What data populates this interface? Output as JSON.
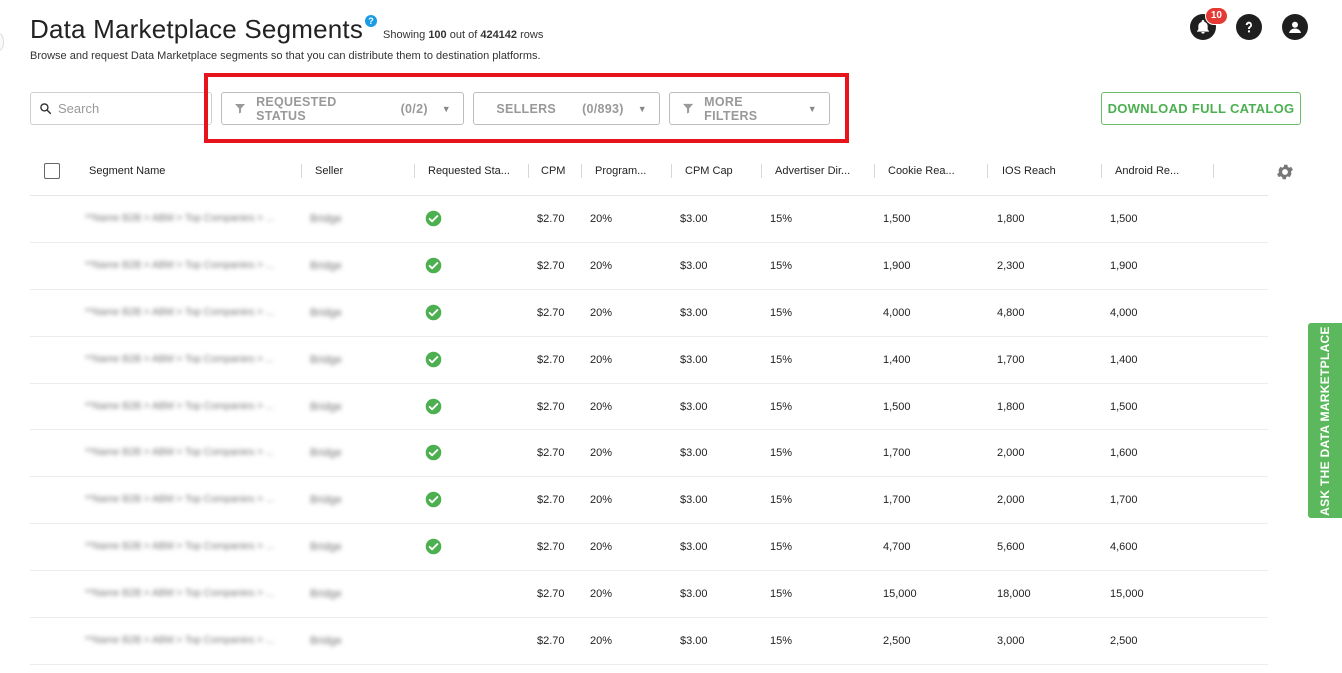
{
  "header": {
    "title": "Data Marketplace Segments",
    "help_glyph": "?",
    "showing_prefix": "Showing",
    "showing_count": "100",
    "showing_mid": "out of",
    "total_rows": "424142",
    "showing_suffix": "rows",
    "subtitle": "Browse and request Data Marketplace segments so that you can distribute them to destination platforms."
  },
  "top_icons": {
    "notifications_count": "10",
    "icons": [
      "bell-icon",
      "help-circle-icon",
      "user-avatar-icon"
    ]
  },
  "search": {
    "placeholder": "Search"
  },
  "filters": [
    {
      "label": "REQUESTED STATUS",
      "count": "(0/2)"
    },
    {
      "label": "SELLERS",
      "count": "(0/893)"
    },
    {
      "label": "MORE FILTERS",
      "count": ""
    }
  ],
  "download_label": "DOWNLOAD FULL CATALOG",
  "side_tab_label": "ASK THE DATA MARKETPLACE",
  "colors": {
    "accent_green": "#4caf50",
    "highlight_red": "#e8141c",
    "help_blue": "#1a9be6",
    "badge_red": "#e53935"
  },
  "table": {
    "columns": [
      "Segment Name",
      "Seller",
      "Requested Sta...",
      "CPM",
      "Program...",
      "CPM Cap",
      "Advertiser Dir...",
      "Cookie Rea...",
      "IOS Reach",
      "Android Re..."
    ],
    "rows": [
      {
        "name": "**Name B2B > ABM > Top Companies > ...",
        "seller": "Bridge",
        "requested": true,
        "cpm": "$2.70",
        "program": "20%",
        "cap": "$3.00",
        "adv": "15%",
        "cookie": "1,500",
        "ios": "1,800",
        "android": "1,500"
      },
      {
        "name": "**Name B2B > ABM > Top Companies > ...",
        "seller": "Bridge",
        "requested": true,
        "cpm": "$2.70",
        "program": "20%",
        "cap": "$3.00",
        "adv": "15%",
        "cookie": "1,900",
        "ios": "2,300",
        "android": "1,900"
      },
      {
        "name": "**Name B2B > ABM > Top Companies > ...",
        "seller": "Bridge",
        "requested": true,
        "cpm": "$2.70",
        "program": "20%",
        "cap": "$3.00",
        "adv": "15%",
        "cookie": "4,000",
        "ios": "4,800",
        "android": "4,000"
      },
      {
        "name": "**Name B2B > ABM > Top Companies > ...",
        "seller": "Bridge",
        "requested": true,
        "cpm": "$2.70",
        "program": "20%",
        "cap": "$3.00",
        "adv": "15%",
        "cookie": "1,400",
        "ios": "1,700",
        "android": "1,400"
      },
      {
        "name": "**Name B2B > ABM > Top Companies > ...",
        "seller": "Bridge",
        "requested": true,
        "cpm": "$2.70",
        "program": "20%",
        "cap": "$3.00",
        "adv": "15%",
        "cookie": "1,500",
        "ios": "1,800",
        "android": "1,500"
      },
      {
        "name": "**Name B2B > ABM > Top Companies > ...",
        "seller": "Bridge",
        "requested": true,
        "cpm": "$2.70",
        "program": "20%",
        "cap": "$3.00",
        "adv": "15%",
        "cookie": "1,700",
        "ios": "2,000",
        "android": "1,600"
      },
      {
        "name": "**Name B2B > ABM > Top Companies > ...",
        "seller": "Bridge",
        "requested": true,
        "cpm": "$2.70",
        "program": "20%",
        "cap": "$3.00",
        "adv": "15%",
        "cookie": "1,700",
        "ios": "2,000",
        "android": "1,700"
      },
      {
        "name": "**Name B2B > ABM > Top Companies > ...",
        "seller": "Bridge",
        "requested": true,
        "cpm": "$2.70",
        "program": "20%",
        "cap": "$3.00",
        "adv": "15%",
        "cookie": "4,700",
        "ios": "5,600",
        "android": "4,600"
      },
      {
        "name": "**Name B2B > ABM > Top Companies > ...",
        "seller": "Bridge",
        "requested": false,
        "cpm": "$2.70",
        "program": "20%",
        "cap": "$3.00",
        "adv": "15%",
        "cookie": "15,000",
        "ios": "18,000",
        "android": "15,000"
      },
      {
        "name": "**Name B2B > ABM > Top Companies > ...",
        "seller": "Bridge",
        "requested": false,
        "cpm": "$2.70",
        "program": "20%",
        "cap": "$3.00",
        "adv": "15%",
        "cookie": "2,500",
        "ios": "3,000",
        "android": "2,500"
      }
    ]
  }
}
